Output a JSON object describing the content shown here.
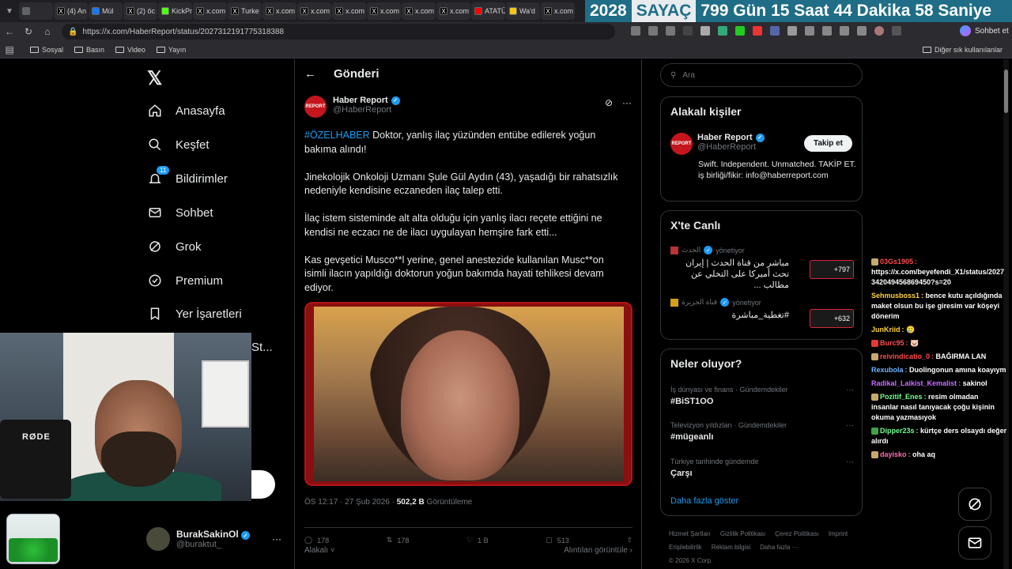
{
  "browser": {
    "tabs": [
      {
        "label": "",
        "color": "#5f6368"
      },
      {
        "label": "(4) An",
        "color": "#000000"
      },
      {
        "label": "Mül",
        "color": "#1877f2"
      },
      {
        "label": "(2) öc",
        "color": "#000000"
      },
      {
        "label": "KickPr",
        "color": "#53fc18"
      },
      {
        "label": "x.com",
        "color": "#000000"
      },
      {
        "label": "Turke",
        "color": "#000000"
      },
      {
        "label": "x.com",
        "color": "#000000"
      },
      {
        "label": "x.com",
        "color": "#000000"
      },
      {
        "label": "x.com",
        "color": "#000000"
      },
      {
        "label": "x.com",
        "color": "#000000"
      },
      {
        "label": "x.com",
        "color": "#000000"
      },
      {
        "label": "x.com",
        "color": "#000000"
      },
      {
        "label": "ATATÜ",
        "color": "#ff0000"
      },
      {
        "label": "Wa'd",
        "color": "#f5c518"
      },
      {
        "label": "x.com",
        "color": "#000000"
      }
    ],
    "url": "https://x.com/HaberReport/status/2027312191775318388",
    "copilot_label": "Sohbet et",
    "bookmarks": [
      "Sosyal",
      "Basın",
      "Video",
      "Yayın"
    ],
    "other_bookmarks": "Diğer sık kullanılanlar"
  },
  "counter": {
    "year": "2028",
    "label": "SAYAÇ",
    "rest": "799 Gün  15 Saat  44 Dakika  58 Saniye"
  },
  "nav": {
    "items": [
      "Anasayfa",
      "Keşfet",
      "Bildirimler",
      "Sohbet",
      "Grok",
      "Premium",
      "Yer İşaretleri"
    ],
    "notif_badge": "11",
    "partial": "St..."
  },
  "profile": {
    "name": "BurakSakinOl",
    "handle": "@buraktut_"
  },
  "main": {
    "header": "Gönderi",
    "author_name": "Haber Report",
    "author_handle": "@HaberReport",
    "logo_text": "REPORT",
    "hashtag": "#ÖZELHABER",
    "para1": " Doktor, yanlış ilaç yüzünden entübe edilerek yoğun bakıma alındı!",
    "para2": "Jinekolojik Onkoloji Uzmanı Şule Gül Aydın (43), yaşadığı bir rahatsızlık nedeniyle kendisine eczaneden ilaç talep etti.",
    "para3": "İlaç istem sisteminde alt alta olduğu için yanlış ilacı reçete ettiğini ne kendisi ne eczacı ne de ilacı uygulayan hemşire fark etti...",
    "para4": "Kas gevşetici Musco**l yerine, genel anestezide kullanılan Musc**on isimli ilacın yapıldığı doktorun yoğun bakımda hayati tehlikesi devam ediyor.",
    "time": "ÖS 12:17 · 27 Şub 2026 · ",
    "views": "502,2 B",
    "views_label": " Görüntüleme",
    "actions": {
      "reply": "178",
      "repost": "178",
      "like": "1 B",
      "bookmark": "513"
    },
    "related": "Alakalı",
    "quotes": "Alıntılan görüntüle"
  },
  "right": {
    "search_placeholder": "Ara",
    "related_title": "Alakalı kişiler",
    "person_name": "Haber Report",
    "person_handle": "@HaberReport",
    "follow": "Takip et",
    "bio": "Swift. Independent. Unmatched. TAKİP ET. iş birliği/fikir: info@haberreport.com",
    "live_title": "X'te Canlı",
    "live": [
      {
        "channel": "الحدث",
        "role": "yönetiyor",
        "title": "مباشر من قناة الحدث | إيران تحث أميركا على التخلي عن مطالب ...",
        "count": "+797"
      },
      {
        "channel": "قناة الجزيرة",
        "role": "yönetiyor",
        "title": "#تغطية_مباشرة",
        "count": "+632"
      }
    ],
    "trends_title": "Neler oluyor?",
    "trends": [
      {
        "cat": "İş dünyası ve finans · Gündemdekiler",
        "name": "#BiST1OO"
      },
      {
        "cat": "Televizyon yıldızları · Gündemdekiler",
        "name": "#mügeanlı"
      },
      {
        "cat": "Türkiye tarihinde gündemde",
        "name": "Çarşı"
      }
    ],
    "show_more": "Daha fazla göster",
    "footer": [
      "Hizmet Şartları",
      "Gizlilik Politikası",
      "Çerez Politikası",
      "Imprint",
      "Erişilebilirlik",
      "Reklam bilgisi",
      "Daha fazla ···",
      "© 2026 X Corp."
    ]
  },
  "chat": [
    {
      "user": "03Gs1905",
      "color": "#ff4d4d",
      "msg": "https://x.com/beyefendi_X1/status/2027342049456869450?s=20",
      "icon": "#c9a96b"
    },
    {
      "user": "Sehmusboss1",
      "color": "#ffd23f",
      "msg": "bence kutu açıldığında maket olsun bu işe giresim var köşeyi dönerim",
      "icon": ""
    },
    {
      "user": "JunKriid",
      "color": "#ffd23f",
      "msg": "🥲",
      "icon": ""
    },
    {
      "user": "Burc95",
      "color": "#ff4d4d",
      "msg": "🐷",
      "icon": "#e53935"
    },
    {
      "user": "reivindicatio_0",
      "color": "#ff4d4d",
      "msg": "BAĞIRMA LAN",
      "icon": "#c9a96b"
    },
    {
      "user": "Rexubola",
      "color": "#6fb3ff",
      "msg": "Duolingonun amına koayıym",
      "icon": ""
    },
    {
      "user": "Radikal_Laikist_Kemalist",
      "color": "#c86fff",
      "msg": "sakinol",
      "icon": ""
    },
    {
      "user": "Pozitif_Enes",
      "color": "#6fff8f",
      "msg": "resim olmadan insanlar nasıl tanıyacak çoğu kişinin okuma yazmasıyok",
      "icon": "#c9a96b"
    },
    {
      "user": "Dipper23s",
      "color": "#6fff8f",
      "msg": "kürtçe ders olsaydı değer alırdı",
      "icon": "#43a047"
    },
    {
      "user": "dayisko",
      "color": "#ff6fb3",
      "msg": "oha aq",
      "icon": "#c9a96b"
    }
  ],
  "webcam": {
    "mic_brand": "RØDE"
  }
}
